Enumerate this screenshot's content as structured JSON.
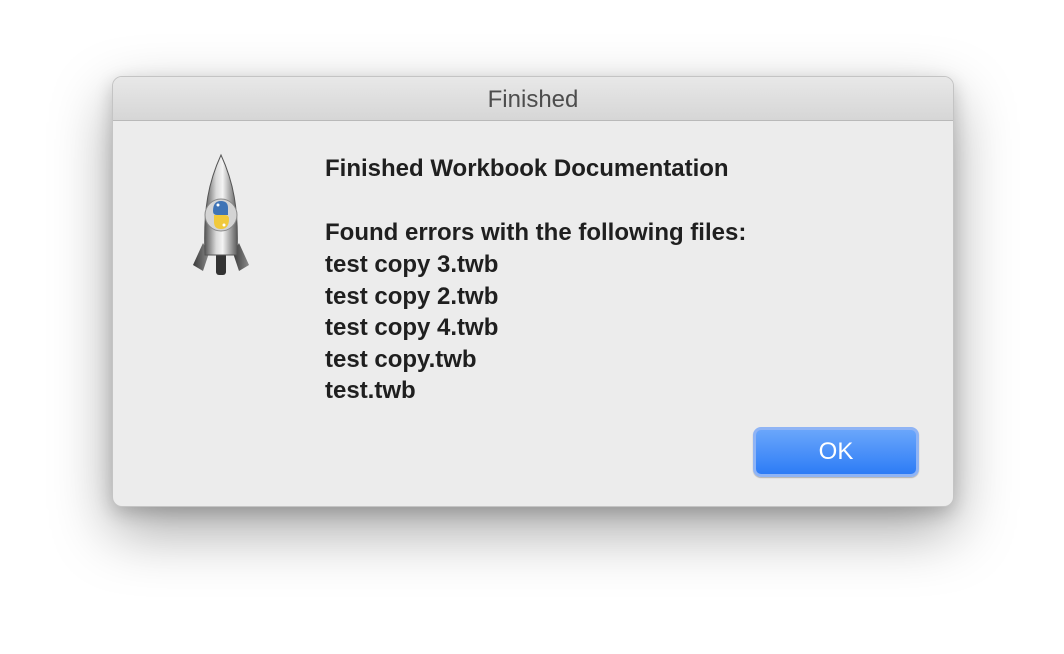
{
  "window": {
    "title": "Finished"
  },
  "dialog": {
    "heading": "Finished Workbook Documentation",
    "subheading": "Found errors with the following files:",
    "files": [
      "test copy 3.twb",
      "test copy 2.twb",
      "test copy 4.twb",
      "test copy.twb",
      "test.twb"
    ],
    "ok_label": "OK"
  },
  "icons": {
    "app_icon": "python-launcher-rocket-icon"
  },
  "colors": {
    "accent": "#3b82f6",
    "dialog_bg": "#ececec",
    "text": "#1f1f1f"
  }
}
